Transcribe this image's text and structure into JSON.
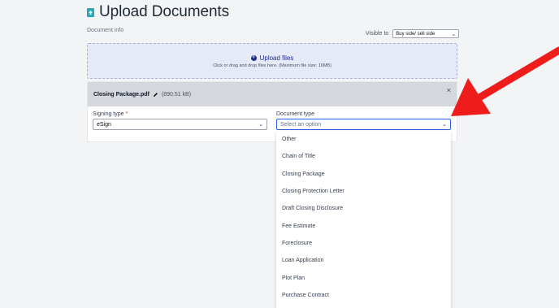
{
  "header": {
    "title": "Upload Documents",
    "icon": "upload-document-icon"
  },
  "document_info": {
    "label": "Document info"
  },
  "visible_to": {
    "label": "Visible to",
    "value": "Buy side/ sell side"
  },
  "upload": {
    "label": "Upload files",
    "hint": "Click or drag and drop files here. (Maximum file size: 10MB)"
  },
  "file": {
    "name": "Closing Package.pdf",
    "size": "(890.51 kB)"
  },
  "signing_type": {
    "label": "Signing type",
    "required_mark": "*",
    "value": "eSign"
  },
  "document_type": {
    "label": "Document type",
    "placeholder": "Select an option",
    "options": [
      "Other",
      "Chain of Title",
      "Closing Package",
      "Closing Protection Letter",
      "Draft Closing Disclosure",
      "Fee Estimate",
      "Foreclosure",
      "Loan Application",
      "Plot Plan",
      "Purchase Contract"
    ]
  },
  "colors": {
    "accent": "#1e2f8a",
    "teal": "#2aa8b7",
    "arrow": "#ef1c1c",
    "focus": "#2563eb"
  }
}
